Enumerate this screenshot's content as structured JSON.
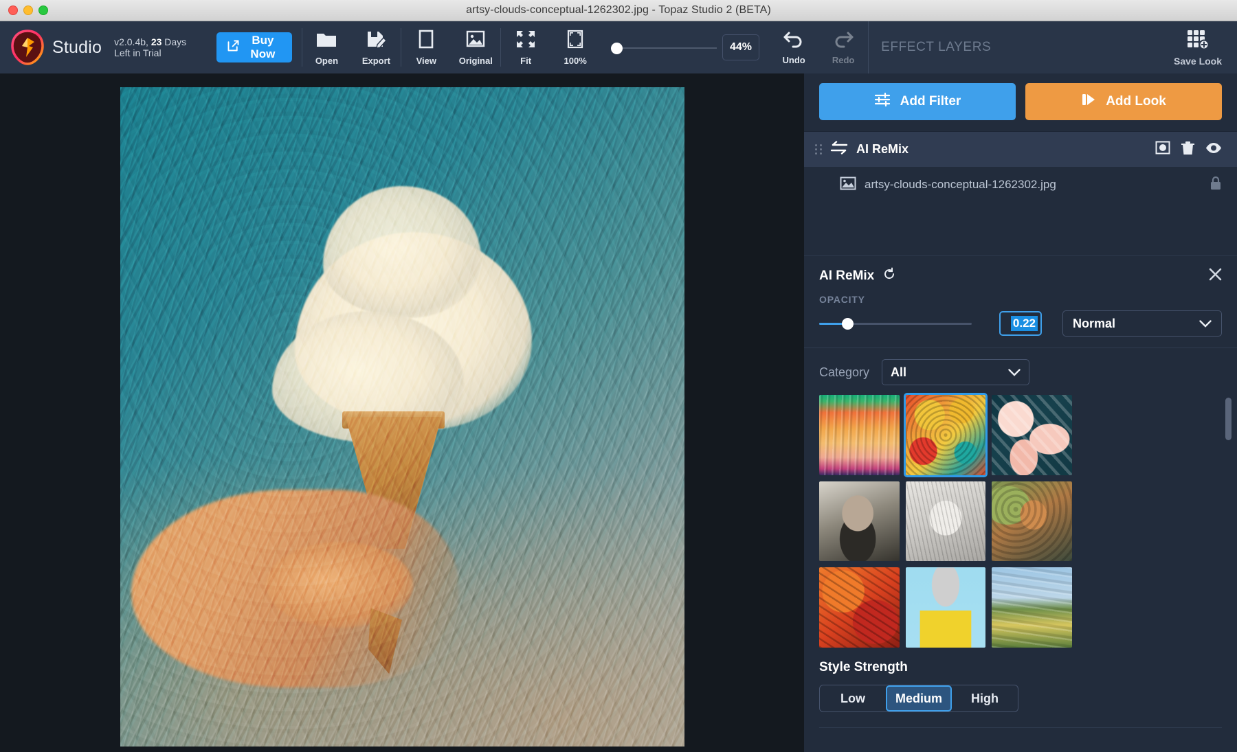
{
  "window": {
    "title": "artsy-clouds-conceptual-1262302.jpg - Topaz Studio 2 (BETA)"
  },
  "brand": {
    "name": "Studio",
    "version": "v2.0.4b,",
    "trial_count": "23",
    "trial_text": " Days Left in Trial",
    "buy_label": "Buy Now"
  },
  "toolbar": {
    "items": [
      {
        "label": "Open",
        "icon": "folder-icon",
        "disabled": false
      },
      {
        "label": "Export",
        "icon": "export-icon",
        "disabled": false
      },
      {
        "label": "View",
        "icon": "view-icon",
        "disabled": false
      },
      {
        "label": "Original",
        "icon": "image-icon",
        "disabled": false
      },
      {
        "label": "Fit",
        "icon": "fit-icon",
        "disabled": false
      },
      {
        "label": "100%",
        "icon": "actual-size-icon",
        "disabled": false
      }
    ],
    "zoom_value": "44%",
    "undo_label": "Undo",
    "redo_label": "Redo"
  },
  "effect_layers": {
    "header": "EFFECT LAYERS",
    "save_look_label": "Save Look",
    "add_filter_label": "Add Filter",
    "add_look_label": "Add Look",
    "layer": {
      "name": "AI ReMix",
      "icon": "swap-arrows-icon",
      "mask_icon": "mask-icon",
      "delete_icon": "trash-icon",
      "visibility_icon": "eye-icon"
    },
    "sublayer": {
      "name": "artsy-clouds-conceptual-1262302.jpg",
      "icon": "image-thumb-icon",
      "lock_icon": "lock-icon"
    }
  },
  "filter_settings": {
    "title": "AI ReMix",
    "reset_icon": "reset-icon",
    "close_icon": "close-icon",
    "opacity_label": "OPACITY",
    "opacity_value": "0.22",
    "blend_mode": "Normal",
    "category_label": "Category",
    "category_value": "All",
    "style_strength_label": "Style Strength",
    "style_strength_options": [
      "Low",
      "Medium",
      "High"
    ],
    "style_strength_selected": "Medium",
    "styles": [
      {
        "name": "sunset-glitch-style",
        "class": "t1",
        "selected": false
      },
      {
        "name": "abstract-swirl-style",
        "class": "t2",
        "selected": true
      },
      {
        "name": "chains-style",
        "class": "t3",
        "selected": false
      },
      {
        "name": "bearded-man-style",
        "class": "t4",
        "selected": false
      },
      {
        "name": "pencil-portrait-style",
        "class": "t5",
        "selected": false
      },
      {
        "name": "redhead-mosaic-style",
        "class": "t6",
        "selected": false
      },
      {
        "name": "autumn-leaves-style",
        "class": "t7",
        "selected": false
      },
      {
        "name": "comic-ink-style",
        "class": "t8",
        "selected": false
      },
      {
        "name": "impressionist-field-style",
        "class": "t9",
        "selected": false
      }
    ]
  },
  "colors": {
    "accent_blue": "#3fa0eb",
    "accent_orange": "#ee9a43",
    "panel_bg": "#222c3c",
    "toolbar_bg": "#293548",
    "canvas_bg": "#14191f",
    "layer_row_bg": "#303c52"
  }
}
